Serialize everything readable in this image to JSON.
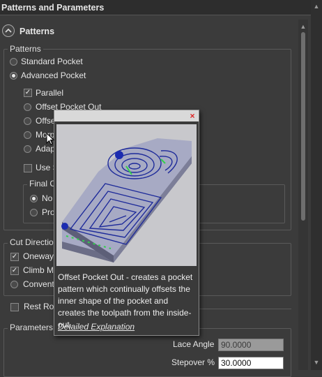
{
  "panel": {
    "title": "Patterns and Parameters"
  },
  "section": {
    "title": "Patterns"
  },
  "patterns_group": {
    "legend": "Patterns",
    "options": [
      {
        "label": "Standard Pocket",
        "selected": false
      },
      {
        "label": "Advanced Pocket",
        "selected": true
      }
    ],
    "advanced": [
      {
        "label": "Parallel",
        "checked": true
      },
      {
        "label": "Offset Pocket Out",
        "selected": false
      },
      {
        "label": "Offse",
        "selected": false
      },
      {
        "label": "Morp",
        "selected": false
      },
      {
        "label": "Adap",
        "selected": false
      }
    ],
    "use_label": "Use S",
    "final_group": {
      "legend": "Final C",
      "options": [
        {
          "label": "No",
          "selected": true
        },
        {
          "label": "Pro",
          "selected": false
        }
      ]
    }
  },
  "cut_direction": {
    "legend": "Cut Directio",
    "items": [
      {
        "label": "Oneway",
        "checked": true
      },
      {
        "label": "Climb M",
        "checked": true
      },
      {
        "label": "Convent",
        "selected": false
      }
    ]
  },
  "rest": {
    "label": "Rest Rou"
  },
  "parameters": {
    "legend": "Parameters",
    "lace_angle": {
      "label": "Lace Angle",
      "value": "90.0000"
    },
    "stepover": {
      "label": "Stepover %",
      "value": "30.0000"
    }
  },
  "popup": {
    "close_glyph": "×",
    "description": "Offset Pocket Out - creates a pocket pattern which continually offsets the inner shape of the pocket and creates the toolpath from the inside-out.",
    "link": "Detailed Explanation"
  },
  "scroll": {
    "up": "▲",
    "down": "▼"
  }
}
